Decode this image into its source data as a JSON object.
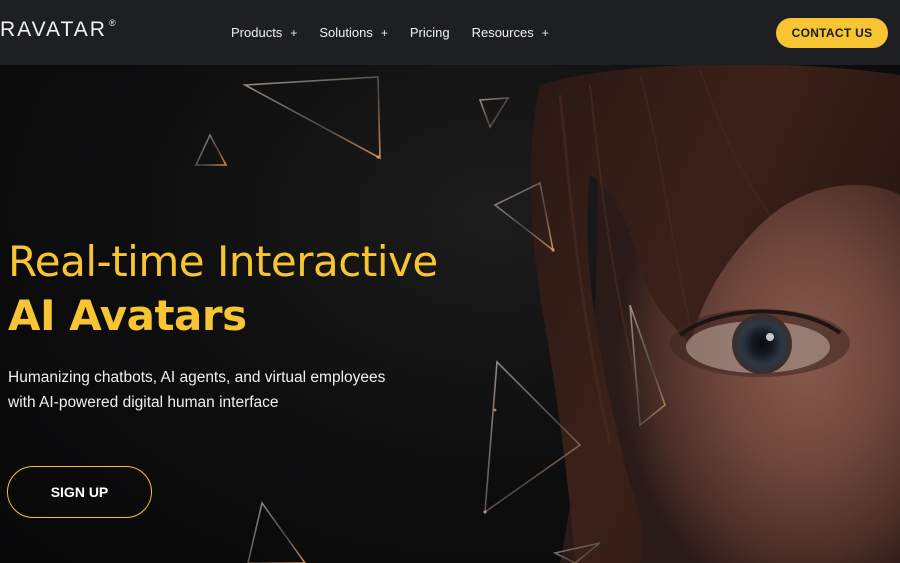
{
  "brand": {
    "logo_text": "RAVATAR",
    "registered": "®"
  },
  "nav": {
    "items": [
      {
        "label": "Products",
        "expand": "+"
      },
      {
        "label": "Solutions",
        "expand": "+"
      },
      {
        "label": "Pricing",
        "expand": ""
      },
      {
        "label": "Resources",
        "expand": "+"
      }
    ],
    "cta_label": "CONTACT US"
  },
  "hero": {
    "title_line1": "Real-time Interactive",
    "title_line2": "AI Avatars",
    "subtitle_line1": "Humanizing chatbots, AI agents, and virtual employees",
    "subtitle_line2": "with AI-powered digital human interface",
    "signup_label": "SIGN UP"
  },
  "colors": {
    "accent": "#f7c531",
    "nav_bg": "#1e1f23",
    "hero_bg": "#0b0b0c"
  }
}
